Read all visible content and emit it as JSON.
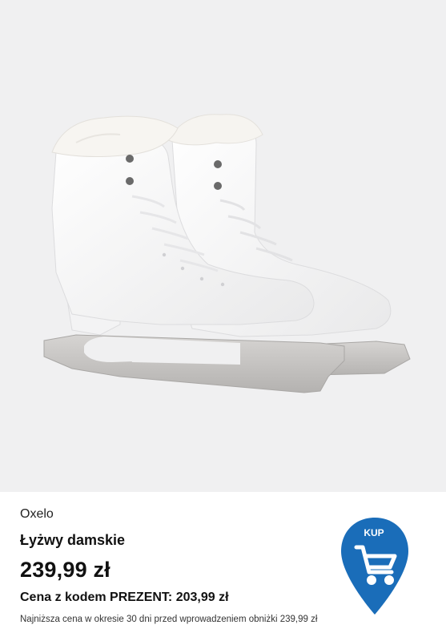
{
  "product": {
    "image_alt": "white figure ice skates",
    "brand": "Oxelo",
    "name": "Łyżwy damskie",
    "price": "239,99 zł",
    "promo_text": "Cena z kodem PREZENT: 203,99 zł",
    "lowest_price_note": "Najniższa cena w okresie 30 dni przed wprowadzeniem obniżki 239,99 zł"
  },
  "buy_button": {
    "label": "KUP",
    "icon": "shopping-cart-icon",
    "color": "#1a6db9"
  },
  "colors": {
    "image_background": "#f0f0f1",
    "blade": "#bfbdbb",
    "boot": "#ffffff"
  }
}
